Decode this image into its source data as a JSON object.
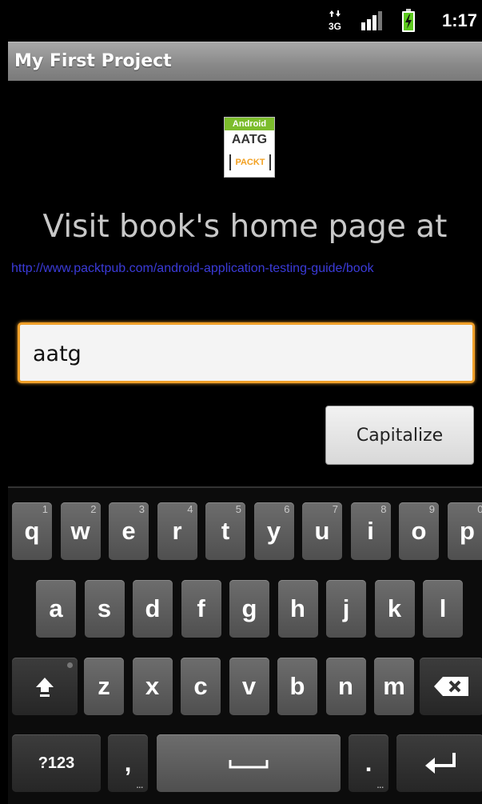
{
  "status": {
    "time": "1:17",
    "network": "3G"
  },
  "titlebar": {
    "title": "My First Project"
  },
  "logo": {
    "top_band": "Android",
    "abbr": "AATG",
    "publisher": "PACKT"
  },
  "content": {
    "heading": "Visit book's home page at",
    "url": "http://www.packtpub.com/android-application-testing-guide/book"
  },
  "edit": {
    "value": "aatg"
  },
  "capitalize_button": {
    "label": "Capitalize"
  },
  "keyboard": {
    "row1": [
      {
        "k": "q",
        "h": "1"
      },
      {
        "k": "w",
        "h": "2"
      },
      {
        "k": "e",
        "h": "3"
      },
      {
        "k": "r",
        "h": "4"
      },
      {
        "k": "t",
        "h": "5"
      },
      {
        "k": "y",
        "h": "6"
      },
      {
        "k": "u",
        "h": "7"
      },
      {
        "k": "i",
        "h": "8"
      },
      {
        "k": "o",
        "h": "9"
      },
      {
        "k": "p",
        "h": "0"
      }
    ],
    "row2": [
      "a",
      "s",
      "d",
      "f",
      "g",
      "h",
      "j",
      "k",
      "l"
    ],
    "row3": [
      "z",
      "x",
      "c",
      "v",
      "b",
      "n",
      "m"
    ],
    "symbols_label": "?123",
    "comma": ",",
    "period": "."
  }
}
